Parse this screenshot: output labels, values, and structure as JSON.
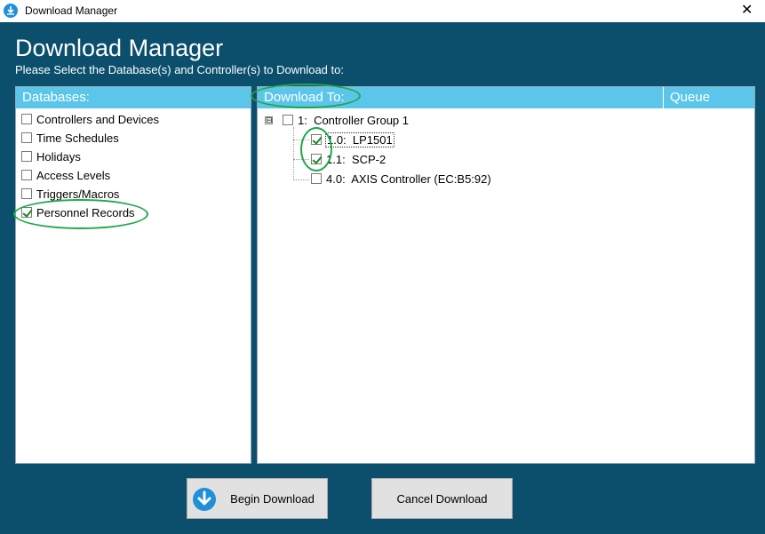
{
  "window": {
    "title": "Download Manager",
    "close_glyph": "✕",
    "app_icon": "download-app-icon"
  },
  "heading": "Download Manager",
  "subheading": "Please Select the Database(s) and Controller(s) to Download to:",
  "databases": {
    "header": "Databases:",
    "items": [
      {
        "label": "Controllers and Devices",
        "checked": false
      },
      {
        "label": "Time Schedules",
        "checked": false
      },
      {
        "label": "Holidays",
        "checked": false
      },
      {
        "label": "Access Levels",
        "checked": false
      },
      {
        "label": "Triggers/Macros",
        "checked": false
      },
      {
        "label": "Personnel Records",
        "checked": true
      }
    ]
  },
  "download_to": {
    "header": "Download To:",
    "queue_header": "Queue",
    "group": {
      "label": "1:  Controller Group 1",
      "checked": false,
      "expander": "⊟"
    },
    "controllers": [
      {
        "label": "1.0:  LP1501",
        "checked": true
      },
      {
        "label": "1.1:  SCP-2",
        "checked": true
      },
      {
        "label": "4.0:  AXIS Controller (EC:B5:92)",
        "checked": false
      }
    ]
  },
  "buttons": {
    "begin": "Begin Download",
    "cancel": "Cancel Download"
  },
  "colors": {
    "background": "#0b4f6c",
    "header": "#5bc6ea",
    "annotation": "#1fa84b",
    "check": "#1b8a1b",
    "download_icon": "#1e90d8"
  }
}
